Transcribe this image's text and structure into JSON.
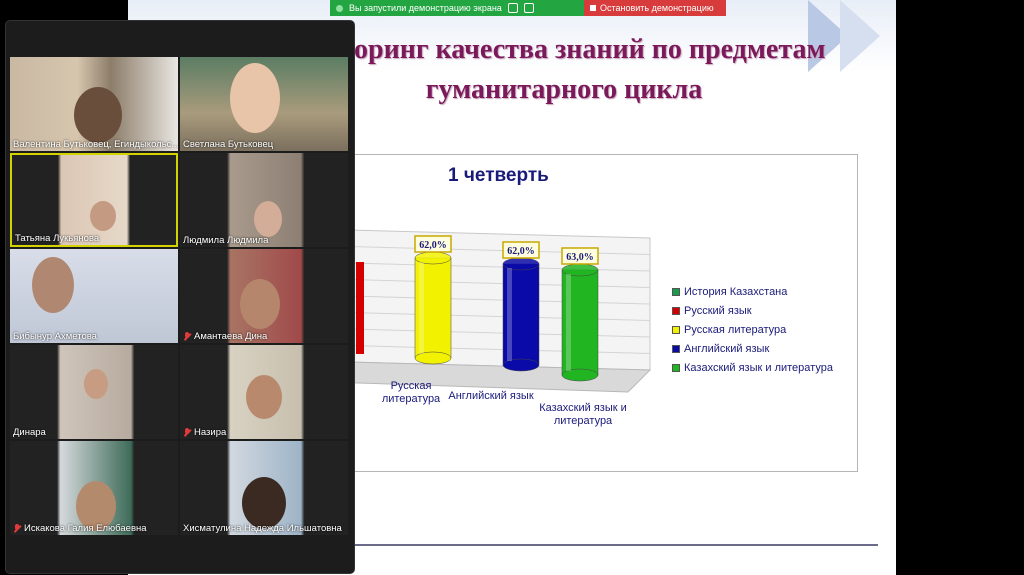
{
  "banner": {
    "sharing_text": "Вы запустили демонстрацию экрана",
    "stop_label": "Остановить демонстрацию"
  },
  "slide": {
    "title_line1": "оринг качества знаний по предметам",
    "title_line2": "гуманитарного цикла"
  },
  "chart_data": {
    "type": "bar",
    "title": "1 четверть",
    "categories": [
      "История Казахстана",
      "Русский язык",
      "Русская литература",
      "Английский язык",
      "Казахский язык и литература"
    ],
    "values": [
      null,
      null,
      62.0,
      62.0,
      63.0
    ],
    "value_labels": [
      "",
      "",
      "62,0%",
      "62,0%",
      "63,0%"
    ],
    "colors": [
      "#1a9a4a",
      "#d40000",
      "#f2f200",
      "#0a0aa8",
      "#22b522"
    ],
    "axis_labels": [
      "Русская литература",
      "Английский язык",
      "Казахский язык и литература"
    ],
    "legend": [
      "История Казахстана",
      "Русский язык",
      "Русская литература",
      "Английский язык",
      "Казахский язык и литература"
    ],
    "legend_position": "right"
  },
  "participants": [
    {
      "name": "Валентина Бутьковец, Егиндыкольс...",
      "muted": false
    },
    {
      "name": "Светлана Бутьковец",
      "muted": false
    },
    {
      "name": "Татьяна Лукьянова",
      "muted": false,
      "active": true
    },
    {
      "name": "Людмила Людмила",
      "muted": false
    },
    {
      "name": "Бибынур Ахметова",
      "muted": false
    },
    {
      "name": "Амантаева Дина",
      "muted": true
    },
    {
      "name": "Динара",
      "muted": false
    },
    {
      "name": "Назира",
      "muted": true
    },
    {
      "name": "Искакова Галия Елюбаевна",
      "muted": true
    },
    {
      "name": "Хисматулина Надежда Ильшатовна",
      "muted": false
    }
  ]
}
